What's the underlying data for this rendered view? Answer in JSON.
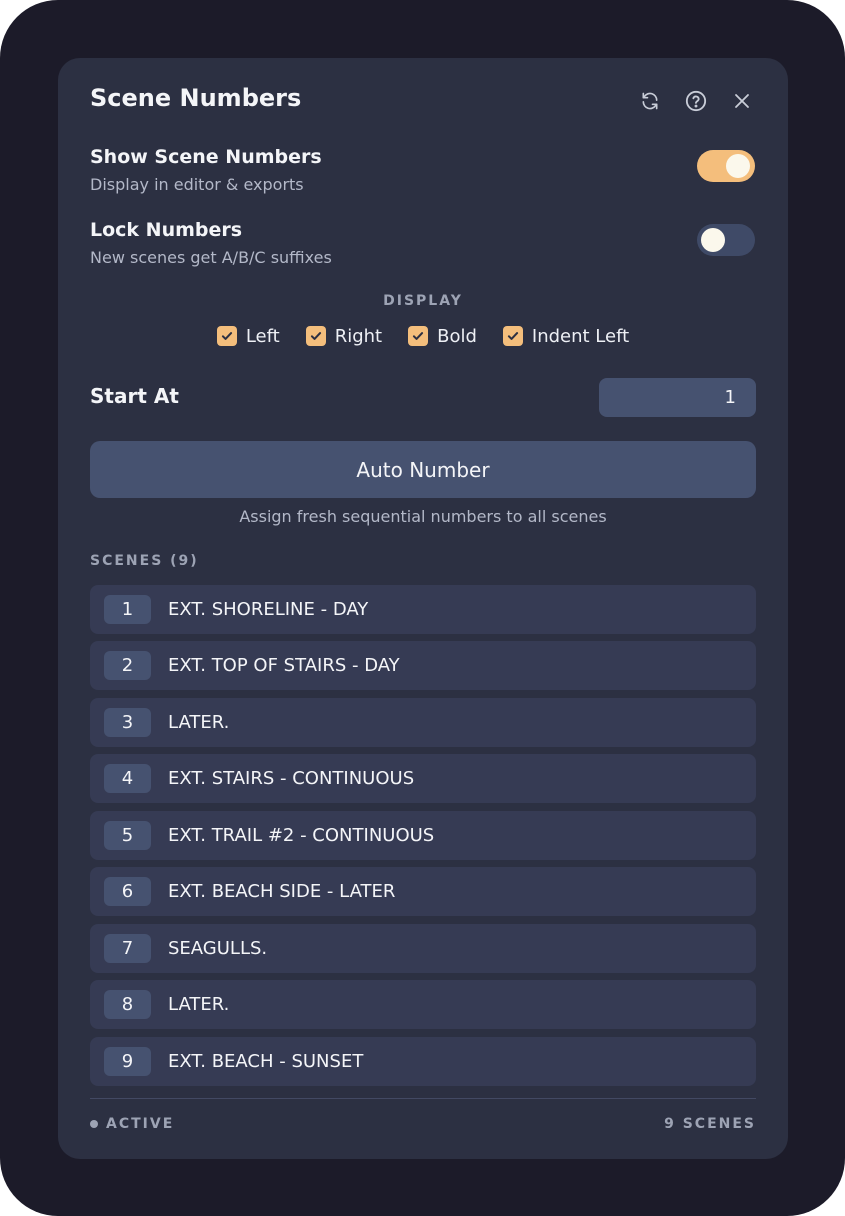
{
  "header": {
    "title": "Scene Numbers",
    "icons": [
      "refresh-icon",
      "help-icon",
      "close-icon"
    ]
  },
  "settings": {
    "show_numbers": {
      "title": "Show Scene Numbers",
      "desc": "Display in editor & exports",
      "enabled": true
    },
    "lock_numbers": {
      "title": "Lock Numbers",
      "desc": "New scenes get A/B/C suffixes",
      "enabled": false
    }
  },
  "display": {
    "label": "DISPLAY",
    "options": [
      {
        "label": "Left",
        "checked": true
      },
      {
        "label": "Right",
        "checked": true
      },
      {
        "label": "Bold",
        "checked": true
      },
      {
        "label": "Indent Left",
        "checked": true
      }
    ]
  },
  "start_at": {
    "label": "Start At",
    "value": "1"
  },
  "auto_number": {
    "label": "Auto Number",
    "help": "Assign fresh sequential numbers to all scenes"
  },
  "scenes": {
    "label": "SCENES (9)",
    "items": [
      {
        "num": "1",
        "slug": "EXT. SHORELINE - DAY"
      },
      {
        "num": "2",
        "slug": "EXT. TOP OF STAIRS - DAY"
      },
      {
        "num": "3",
        "slug": "LATER."
      },
      {
        "num": "4",
        "slug": "EXT. STAIRS - CONTINUOUS"
      },
      {
        "num": "5",
        "slug": "EXT. TRAIL #2 - CONTINUOUS"
      },
      {
        "num": "6",
        "slug": "EXT. BEACH SIDE - LATER"
      },
      {
        "num": "7",
        "slug": "SEAGULLS."
      },
      {
        "num": "8",
        "slug": "LATER."
      },
      {
        "num": "9",
        "slug": "EXT. BEACH - SUNSET"
      }
    ]
  },
  "footer": {
    "status": "ACTIVE",
    "count": "9 SCENES"
  },
  "colors": {
    "accent": "#f4be7c",
    "panel": "#2c3042",
    "row": "#363b54",
    "control": "#465270"
  }
}
